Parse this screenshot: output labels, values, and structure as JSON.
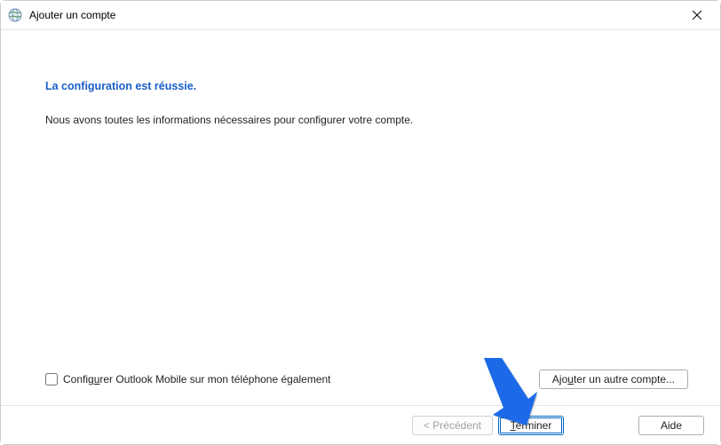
{
  "window": {
    "title": "Ajouter un compte"
  },
  "content": {
    "heading": "La configuration est réussie.",
    "body": "Nous avons toutes les informations nécessaires pour configurer votre compte."
  },
  "checkbox": {
    "prefix": "Config",
    "accel": "u",
    "suffix": "rer Outlook Mobile sur mon téléphone également",
    "checked": false
  },
  "buttons": {
    "add_prefix": "Ajo",
    "add_accel": "u",
    "add_suffix": "ter un autre compte...",
    "back": "< Précédent",
    "finish_accel": "T",
    "finish_suffix": "erminer",
    "help": "Aide"
  }
}
